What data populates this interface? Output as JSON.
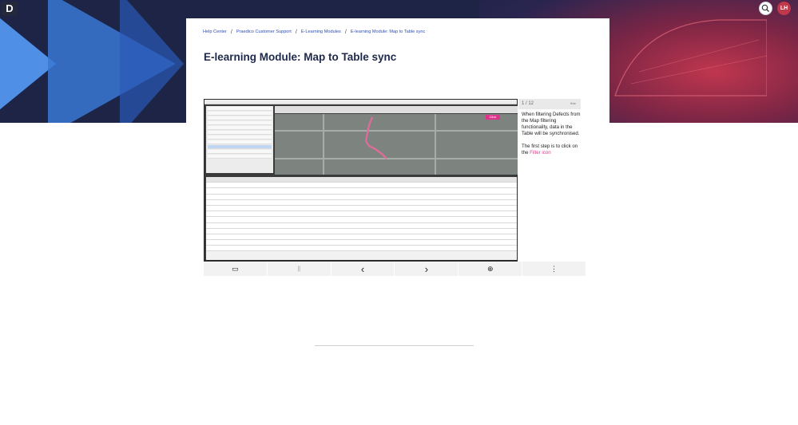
{
  "header": {
    "logo_text": "D",
    "avatar_initials": "LH"
  },
  "breadcrumb": [
    {
      "label": "Help Center"
    },
    {
      "label": "Praedico Customer Support"
    },
    {
      "label": "E-Learning Modules"
    },
    {
      "label": "E-learning Module: Map to Table sync"
    }
  ],
  "breadcrumb_separator": "/",
  "page_title": "E-learning Module: Map to Table sync",
  "player": {
    "step_counter": "1 / 12",
    "close_label": "Hide",
    "click_badge": "Click",
    "tip_text": "When filtering Defects from the Map filtering functionality, data in the Table will be synchronised.",
    "tip_text2_prefix": "The first step is to click on the ",
    "tip_text2_link": "Filter icon",
    "controls": [
      {
        "name": "caption-icon",
        "glyph": "▭"
      },
      {
        "name": "pause-icon",
        "glyph": "||"
      },
      {
        "name": "previous-icon",
        "glyph": "‹"
      },
      {
        "name": "next-icon",
        "glyph": "›"
      },
      {
        "name": "zoom-in-icon",
        "glyph": "⊕"
      },
      {
        "name": "more-options-icon",
        "glyph": "⋮"
      }
    ]
  },
  "colors": {
    "brand_blue": "#2f4fb3",
    "accent_pink": "#e0338e",
    "hero_bg": "#1d2446",
    "avatar_bg": "#c0384b"
  }
}
